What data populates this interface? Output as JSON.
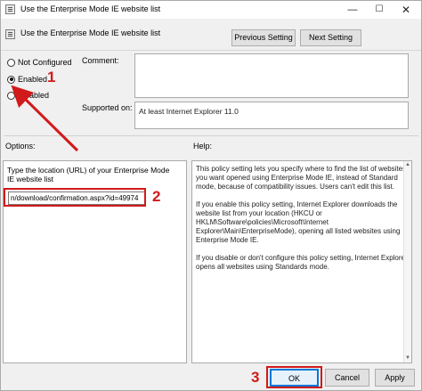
{
  "window": {
    "title": "Use the Enterprise Mode IE website list",
    "controls": {
      "minimize": "—",
      "maximize": "☐",
      "close": "✕"
    }
  },
  "header": {
    "setting_title": "Use the Enterprise Mode IE website list",
    "prev_button": "Previous Setting",
    "next_button": "Next Setting"
  },
  "state": {
    "options": [
      {
        "label": "Not Configured",
        "checked": false
      },
      {
        "label": "Enabled",
        "checked": true
      },
      {
        "label": "Disabled",
        "checked": false
      }
    ]
  },
  "fields": {
    "comment_label": "Comment:",
    "comment_value": "",
    "supported_label": "Supported on:",
    "supported_value": "At least Internet Explorer 11.0"
  },
  "options_pane": {
    "label": "Options:",
    "description": "Type the location (URL) of your Enterprise Mode IE website list",
    "url_value": "n/download/confirmation.aspx?id=49974"
  },
  "help_pane": {
    "label": "Help:",
    "paragraphs": [
      "This policy setting lets you specify where to find the list of websites you want opened using Enterprise Mode IE, instead of Standard mode, because of compatibility issues. Users can't edit this list.",
      "If you enable this policy setting, Internet Explorer downloads the website list from your location (HKCU or HKLM\\Software\\policies\\Microsoft\\Internet Explorer\\Main\\EnterpriseMode), opening all listed websites using Enterprise Mode IE.",
      "If you disable or don't configure this policy setting, Internet Explorer opens all websites using Standards mode."
    ]
  },
  "footer": {
    "ok_button": "OK",
    "cancel_button": "Cancel",
    "apply_button": "Apply"
  },
  "annotations": {
    "step1": "1",
    "step2": "2",
    "step3": "3",
    "color": "#d11a1a"
  },
  "colors": {
    "accent": "#0078d7",
    "annotation": "#d11a1a"
  }
}
